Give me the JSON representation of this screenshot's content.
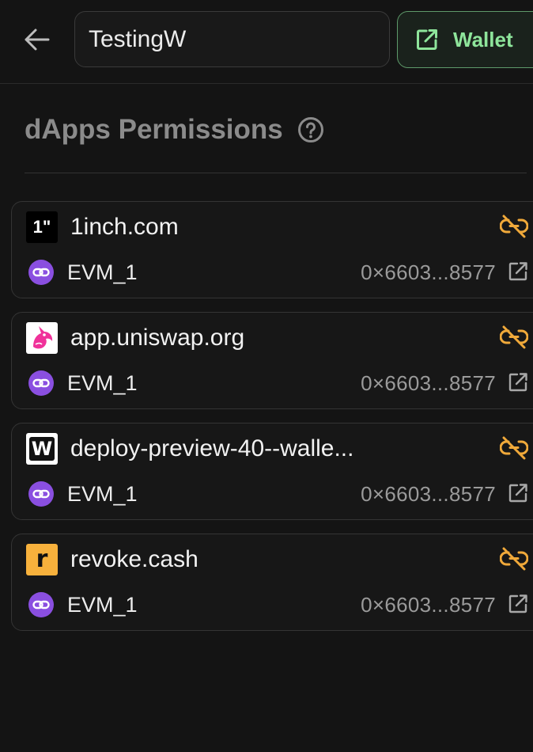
{
  "header": {
    "back_icon": "arrow-left-icon",
    "wallet_name_value": "TestingW",
    "wallet_button_label": "Wallet",
    "wallet_button_icon": "external-link-icon"
  },
  "section": {
    "title": "dApps Permissions",
    "help_icon": "question-circle-icon"
  },
  "colors": {
    "background": "#141414",
    "accent_green": "#8ee59b",
    "unlink_orange": "#f0a93a",
    "chain_purple": "#8a4fe0"
  },
  "permissions": [
    {
      "site": "1inch.com",
      "logo": "1inch-logo",
      "logo_text": "1\"",
      "network": "EVM_1",
      "address": "0×6603...8577"
    },
    {
      "site": "app.uniswap.org",
      "logo": "uniswap-logo",
      "logo_text": "",
      "network": "EVM_1",
      "address": "0×6603...8577"
    },
    {
      "site": "deploy-preview-40--walle...",
      "logo": "w-logo",
      "logo_text": "W",
      "network": "EVM_1",
      "address": "0×6603...8577"
    },
    {
      "site": "revoke.cash",
      "logo": "revoke-logo",
      "logo_text": "r",
      "network": "EVM_1",
      "address": "0×6603...8577"
    }
  ]
}
